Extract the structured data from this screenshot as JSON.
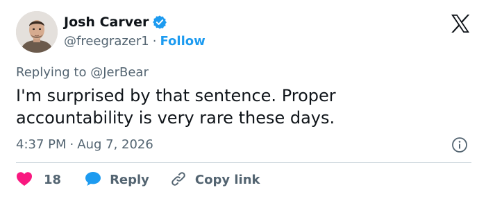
{
  "author": {
    "name": "Josh Carver",
    "handle": "@freegrazer1",
    "separator": "·",
    "follow_label": "Follow"
  },
  "reply_context": {
    "prefix": "Replying to",
    "mention": "@JerBear"
  },
  "tweet": {
    "lines": [
      "I'm surprised by that sentence. Proper",
      "accountability is very rare these days."
    ]
  },
  "meta": {
    "time": "4:37 PM",
    "separator": "·",
    "date": "Aug 7, 2026"
  },
  "actions": {
    "like_count": "18",
    "reply_label": "Reply",
    "copy_link_label": "Copy link"
  },
  "icons": {
    "brand": "x-logo-icon",
    "verified": "verified-badge-icon",
    "info": "info-icon",
    "like": "heart-icon",
    "reply": "speech-bubble-icon",
    "copy": "link-icon"
  },
  "colors": {
    "accent": "#1d9bf0",
    "like": "#f91880",
    "text": "#0f1419",
    "muted": "#536471",
    "divider": "#cfd9de"
  }
}
